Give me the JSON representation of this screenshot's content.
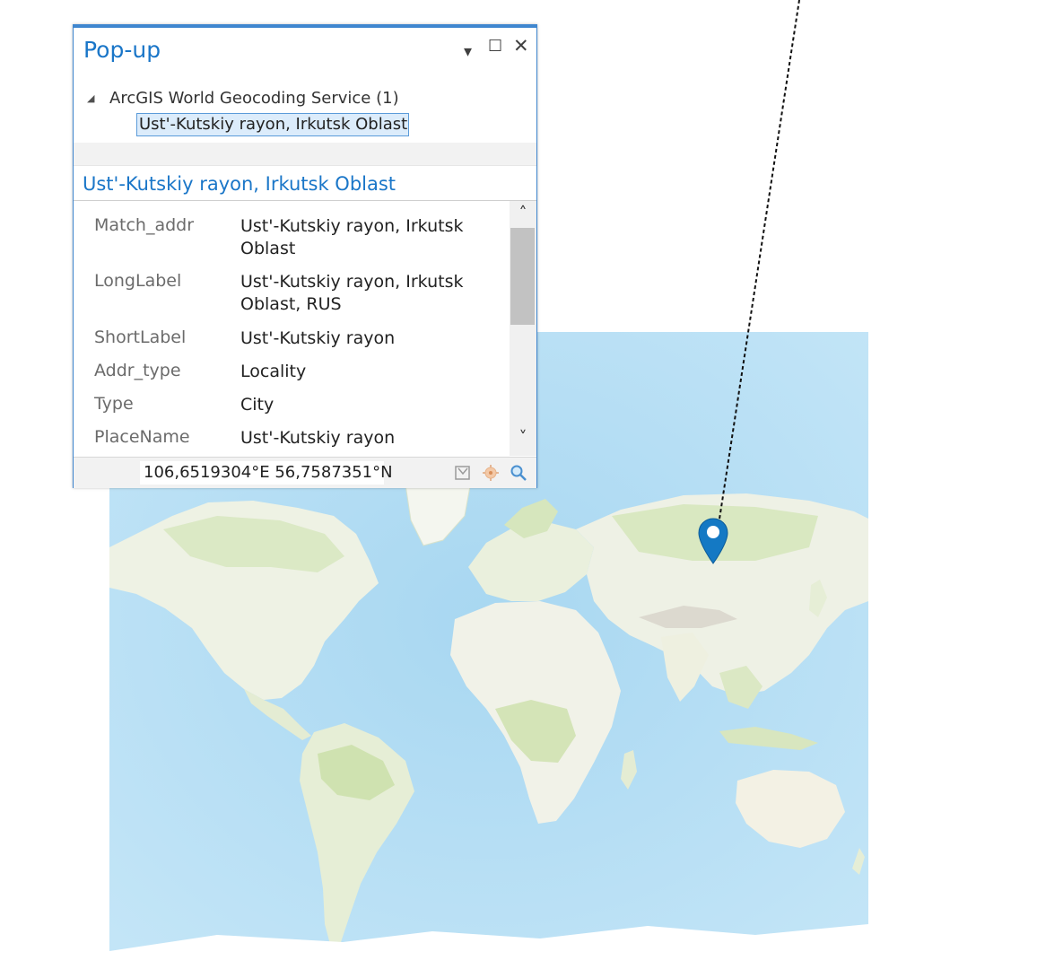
{
  "popup": {
    "title": "Pop-up",
    "controls": {
      "menu": "▾",
      "maximize": "☐",
      "close": "✕"
    },
    "tree": {
      "expander": "◢",
      "layer_label": "ArcGIS World Geocoding Service  (1)",
      "selected_feature": "Ust'-Kutskiy rayon, Irkutsk Oblast"
    },
    "feature_heading": "Ust'-Kutskiy rayon, Irkutsk Oblast",
    "attributes": [
      {
        "key": "Match_addr",
        "value": "Ust'-Kutskiy rayon, Irkutsk Oblast"
      },
      {
        "key": "LongLabel",
        "value": "Ust'-Kutskiy rayon, Irkutsk Oblast, RUS"
      },
      {
        "key": "ShortLabel",
        "value": "Ust'-Kutskiy rayon"
      },
      {
        "key": "Addr_type",
        "value": "Locality"
      },
      {
        "key": "Type",
        "value": "City"
      },
      {
        "key": "PlaceName",
        "value": "Ust'-Kutskiy rayon"
      }
    ],
    "scrollbar": {
      "up": "˄",
      "down": "˅"
    },
    "footer": {
      "coordinates": "106,6519304°E 56,7587351°N",
      "icons": [
        "flash-icon",
        "pan-to-icon",
        "zoom-to-icon"
      ]
    }
  },
  "map": {
    "icons": [
      "location-pin-icon"
    ],
    "colors": {
      "ocean": "#bfe3f6",
      "land": "#eef2e6",
      "vegetation": "#d9e8c2",
      "ice": "#ffffff",
      "pin": "#1479c4"
    }
  }
}
